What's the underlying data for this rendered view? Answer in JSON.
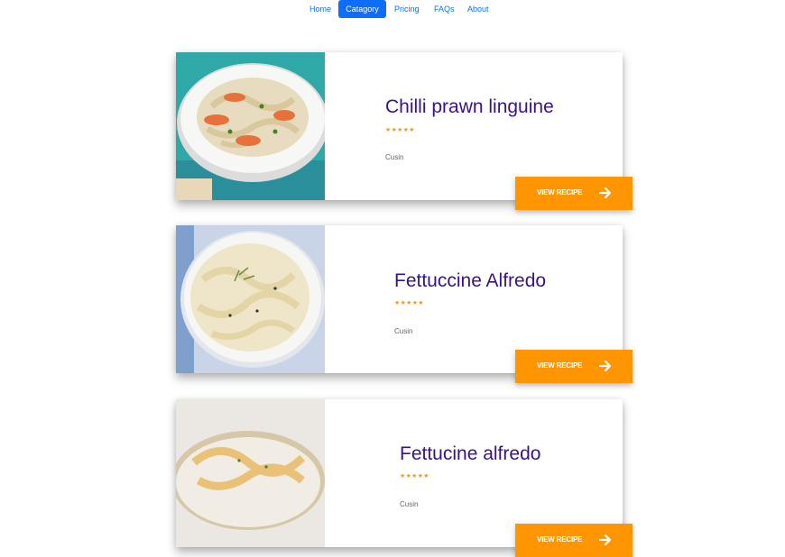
{
  "nav": {
    "items": [
      {
        "label": "Home",
        "active": false
      },
      {
        "label": "Catagory",
        "active": true
      },
      {
        "label": "Pricing",
        "active": false
      },
      {
        "label": "FAQs",
        "active": false
      },
      {
        "label": "About",
        "active": false
      }
    ]
  },
  "recipes": [
    {
      "title": "Chilli prawn linguine",
      "rating_stars": "★★★★★",
      "rating": 5,
      "cuisine": "Cusin",
      "button_label": "VIEW RECIPE",
      "button_icon": "arrow-right-icon"
    },
    {
      "title": "Fettuccine Alfredo",
      "rating_stars": "★★★★★",
      "rating": 5,
      "cuisine": "Cusin",
      "button_label": "VIEW RECIPE",
      "button_icon": "arrow-right-icon"
    },
    {
      "title": "Fettucine alfredo",
      "rating_stars": "★★★★★",
      "rating": 5,
      "cuisine": "Cusin",
      "button_label": "VIEW RECIPE",
      "button_icon": "arrow-right-icon"
    }
  ],
  "colors": {
    "nav_link": "#0d6efd",
    "nav_active_bg": "#0d6efd",
    "title": "#3a1287",
    "stars": "#f39c12",
    "button_bg": "#ff9500"
  }
}
